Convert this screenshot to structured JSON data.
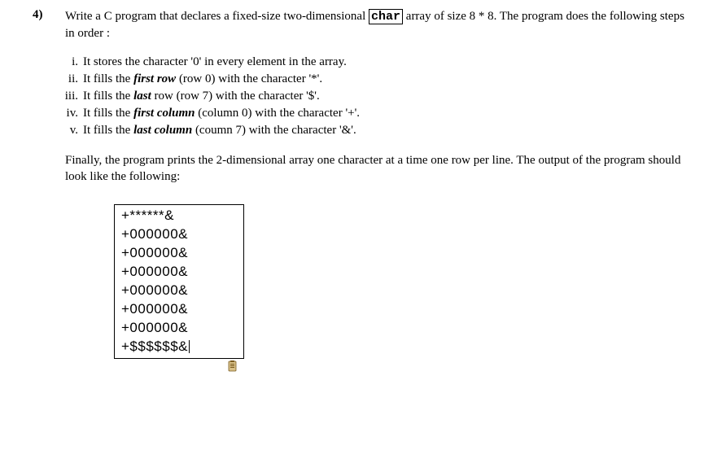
{
  "question": {
    "number": "4)",
    "intro_pre": "Write a C program that declares a fixed-size two-dimensional ",
    "boxed_word": "char",
    "intro_post": " array of size 8 * 8.  The program does the following steps in order :"
  },
  "steps": [
    {
      "num": "i.",
      "pre": "It stores the character '0' in every element in the array.",
      "bold": "",
      "post": ""
    },
    {
      "num": "ii.",
      "pre": "It fills the ",
      "bold": "first row",
      "post": " (row 0) with the character '*'."
    },
    {
      "num": "iii.",
      "pre": "It fills the ",
      "bold": "last",
      "post": " row (row 7) with the character '$'."
    },
    {
      "num": "iv.",
      "pre": "It fills the ",
      "bold": "first column",
      "post": " (column 0) with the character '+'."
    },
    {
      "num": "v.",
      "pre": "It fills the ",
      "bold": "last column",
      "post": " (coumn 7) with the character '&'."
    }
  ],
  "final": "Finally, the program prints the 2-dimensional array one character at a time one row per line. The output of the program should look like the following:",
  "output": {
    "lines": [
      "+******&",
      "+000000&",
      "+000000&",
      "+000000&",
      "+000000&",
      "+000000&",
      "+000000&",
      "+$$$$$$&"
    ]
  }
}
